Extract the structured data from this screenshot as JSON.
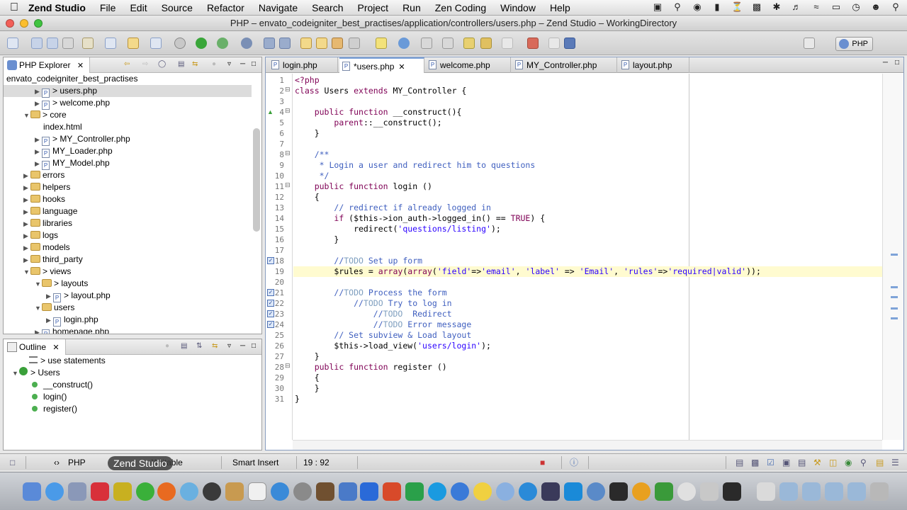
{
  "menubar": {
    "app_name": "Zend Studio",
    "items": [
      "File",
      "Edit",
      "Source",
      "Refactor",
      "Navigate",
      "Search",
      "Project",
      "Run",
      "Zen Coding",
      "Window",
      "Help"
    ]
  },
  "window": {
    "title": "PHP – envato_codeigniter_best_practises/application/controllers/users.php – Zend Studio – WorkingDirectory"
  },
  "toolbar": {
    "perspective_label": "PHP"
  },
  "explorer": {
    "tab_label": "PHP Explorer",
    "project": "envato_codeigniter_best_practises",
    "rows": [
      {
        "label": "> users.php",
        "kind": "file",
        "depth": 3,
        "arrow": "▶",
        "selected": true
      },
      {
        "label": "> welcome.php",
        "kind": "file",
        "depth": 3,
        "arrow": "▶"
      },
      {
        "label": "> core",
        "kind": "folder",
        "depth": 2,
        "arrow": "▼"
      },
      {
        "label": "index.html",
        "kind": "plain",
        "depth": 3,
        "arrow": ""
      },
      {
        "label": "> MY_Controller.php",
        "kind": "file",
        "depth": 3,
        "arrow": "▶"
      },
      {
        "label": "MY_Loader.php",
        "kind": "file",
        "depth": 3,
        "arrow": "▶"
      },
      {
        "label": "MY_Model.php",
        "kind": "file",
        "depth": 3,
        "arrow": "▶"
      },
      {
        "label": "errors",
        "kind": "folder",
        "depth": 2,
        "arrow": "▶"
      },
      {
        "label": "helpers",
        "kind": "folder",
        "depth": 2,
        "arrow": "▶"
      },
      {
        "label": "hooks",
        "kind": "folder",
        "depth": 2,
        "arrow": "▶"
      },
      {
        "label": "language",
        "kind": "folder",
        "depth": 2,
        "arrow": "▶"
      },
      {
        "label": "libraries",
        "kind": "folder",
        "depth": 2,
        "arrow": "▶"
      },
      {
        "label": "logs",
        "kind": "folder",
        "depth": 2,
        "arrow": "▶"
      },
      {
        "label": "models",
        "kind": "folder",
        "depth": 2,
        "arrow": "▶"
      },
      {
        "label": "third_party",
        "kind": "folder",
        "depth": 2,
        "arrow": "▶"
      },
      {
        "label": "> views",
        "kind": "folder",
        "depth": 2,
        "arrow": "▼"
      },
      {
        "label": "> layouts",
        "kind": "folder",
        "depth": 3,
        "arrow": "▼"
      },
      {
        "label": "> layout.php",
        "kind": "file",
        "depth": 4,
        "arrow": "▶"
      },
      {
        "label": "users",
        "kind": "folder",
        "depth": 3,
        "arrow": "▼"
      },
      {
        "label": "login.php",
        "kind": "file",
        "depth": 4,
        "arrow": "▶"
      },
      {
        "label": "homepage.php",
        "kind": "file",
        "depth": 3,
        "arrow": "▶"
      }
    ]
  },
  "outline": {
    "tab_label": "Outline",
    "rows": [
      {
        "label": "> use statements",
        "kind": "use",
        "depth": 1,
        "arrow": ""
      },
      {
        "label": "> Users",
        "kind": "class",
        "depth": 0,
        "arrow": "▼"
      },
      {
        "label": "__construct()",
        "kind": "method",
        "depth": 2,
        "arrow": ""
      },
      {
        "label": "login()",
        "kind": "method",
        "depth": 2,
        "arrow": ""
      },
      {
        "label": "register()",
        "kind": "method",
        "depth": 2,
        "arrow": ""
      }
    ]
  },
  "editor": {
    "tabs": [
      {
        "label": "login.php",
        "active": false
      },
      {
        "label": "*users.php",
        "active": true
      },
      {
        "label": "welcome.php",
        "active": false
      },
      {
        "label": "MY_Controller.php",
        "active": false
      },
      {
        "label": "layout.php",
        "active": false
      }
    ],
    "highlighted_line": 19,
    "lines": [
      "<?php",
      "class Users extends MY_Controller {",
      "",
      "    public function __construct(){",
      "        parent::__construct();",
      "    }",
      "",
      "    /**",
      "     * Login a user and redirect him to questions",
      "     */",
      "    public function login ()",
      "    {",
      "        // redirect if already logged in",
      "        if ($this->ion_auth->logged_in() == TRUE) {",
      "            redirect('questions/listing');",
      "        }",
      "",
      "        //TODO Set up form",
      "        $rules = array(array('field'=>'email', 'label' => 'Email', 'rules'=>'required|valid'));",
      "",
      "        //TODO Process the form",
      "            //TODO Try to log in",
      "                //TODO  Redirect",
      "                //TODO Error message",
      "        // Set subview & Load layout",
      "        $this->load_view('users/login');",
      "    }",
      "    public function register ()",
      "    {",
      "    }",
      "}"
    ]
  },
  "statusbar": {
    "php_label": "PHP",
    "writable": "Writable",
    "insert_mode": "Smart Insert",
    "position": "19 : 92"
  },
  "tooltip": "Zend Studio",
  "colors": {
    "accent": "#7ea3d8",
    "keyword": "#7f0055",
    "comment": "#3f5fbf",
    "string": "#2a00ff",
    "current_line": "#fffbd0"
  }
}
